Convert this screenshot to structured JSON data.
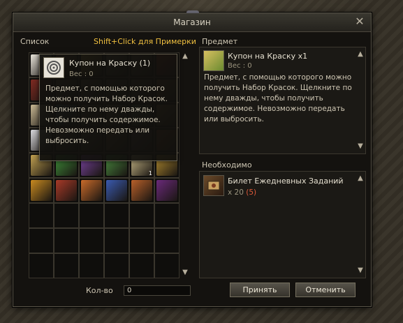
{
  "window": {
    "title": "Магазин"
  },
  "list": {
    "label": "Список",
    "hint": "Shift+Click для Примерки",
    "items": [
      {
        "icon": "coupon-swirl-icon",
        "color": "#e8e4da",
        "count": ""
      },
      {
        "icon": "lute-icon",
        "color": "#8a5a3a",
        "count": ""
      },
      {
        "icon": "bell-icon",
        "color": "#c9a040",
        "count": ""
      },
      {
        "icon": "sword-icon",
        "color": "#7a6a55",
        "count": ""
      },
      {
        "icon": "helmet-icon",
        "color": "#6f5a48",
        "count": ""
      },
      {
        "icon": "red-potion-icon",
        "color": "#9a2e20",
        "count": ""
      },
      {
        "icon": "red-statue-icon",
        "color": "#7e2a22",
        "count": ""
      },
      {
        "icon": "ring-icon",
        "color": "#6a5a4a",
        "count": ""
      },
      {
        "icon": "staff-icon",
        "color": "#6a5a48",
        "count": ""
      },
      {
        "icon": "armor-icon",
        "color": "#5a4e40",
        "count": ""
      },
      {
        "icon": "boots-icon",
        "color": "#5e503f",
        "count": ""
      },
      {
        "icon": "belt-icon",
        "color": "#7a4e30",
        "count": ""
      },
      {
        "icon": "scroll-icon",
        "color": "#c8b893",
        "count": ""
      },
      {
        "icon": "bottle-icon",
        "color": "#4a6a7a",
        "count": ""
      },
      {
        "icon": "shield-icon",
        "color": "#6a5e4a",
        "count": ""
      },
      {
        "icon": "gauntlet-icon",
        "color": "#7a6a50",
        "count": ""
      },
      {
        "icon": "feather-icon",
        "color": "#5a7050",
        "count": ""
      },
      {
        "icon": "pipe-icon",
        "color": "#8a6a40",
        "count": ""
      },
      {
        "icon": "crystal-icon",
        "color": "#d8d8dc",
        "count": ""
      },
      {
        "icon": "amulet-icon",
        "color": "#7a6a58",
        "count": ""
      },
      {
        "icon": "dagger-icon",
        "color": "#6a6050",
        "count": ""
      },
      {
        "icon": "bow-icon",
        "color": "#7a5a3a",
        "count": ""
      },
      {
        "icon": "orb-icon",
        "color": "#6a5060",
        "count": ""
      },
      {
        "icon": "cloak-icon",
        "color": "#8a4a30",
        "count": ""
      },
      {
        "icon": "gold-statue-icon",
        "color": "#c0a050",
        "count": ""
      },
      {
        "icon": "green-ticket-icon",
        "color": "#3f8f3a",
        "count": ""
      },
      {
        "icon": "purple-ticket-icon",
        "color": "#7a44a0",
        "count": ""
      },
      {
        "icon": "green-voucher-icon",
        "color": "#4a8a40",
        "count": ""
      },
      {
        "icon": "beige-voucher-icon",
        "color": "#c8b888",
        "count": "1"
      },
      {
        "icon": "gold-book-icon",
        "color": "#b08a30",
        "count": ""
      },
      {
        "icon": "golden-scroll-icon",
        "color": "#c88a20",
        "count": ""
      },
      {
        "icon": "red-scroll-icon",
        "color": "#a83a28",
        "count": ""
      },
      {
        "icon": "orange-scroll-icon",
        "color": "#c86a2a",
        "count": ""
      },
      {
        "icon": "gift-box-icon",
        "color": "#3a5ab0",
        "count": ""
      },
      {
        "icon": "orange-box-icon",
        "color": "#b8602a",
        "count": ""
      },
      {
        "icon": "purple-book-icon",
        "color": "#6a2a7a",
        "count": ""
      }
    ]
  },
  "tooltip": {
    "name": "Купон на Краску (1)",
    "weight": "Вес :  0",
    "description": "Предмет, с помощью которого можно получить Набор Красок. Щелкните по нему дважды, чтобы получить содержимое. Невозможно передать или выбросить."
  },
  "item_panel": {
    "label": "Предмет",
    "name": "Купон на Краску x1",
    "weight": "Вес :  0",
    "description": "Предмет, с помощью которого можно получить Набор Красок. Щелкните по нему дважды, чтобы получить содержимое. Невозможно передать или выбросить."
  },
  "required": {
    "label": "Необходимо",
    "name": "Билет Ежедневных Заданий",
    "qty": "x 20",
    "have": "(5)"
  },
  "footer": {
    "qty_label": "Кол-во",
    "qty_value": "0",
    "accept": "Принять",
    "cancel": "Отменить"
  }
}
